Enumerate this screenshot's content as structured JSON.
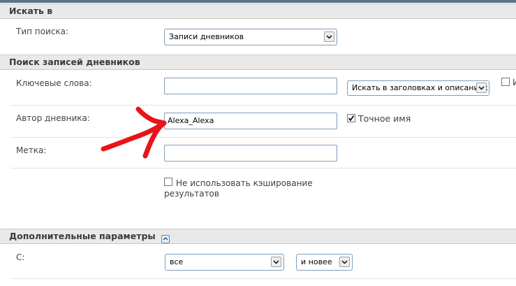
{
  "sections": {
    "search_in": {
      "title": "Искать в",
      "search_type_label": "Тип поиска:",
      "search_type_value": "Записи дневников"
    },
    "diary_search": {
      "title": "Поиск записей дневников",
      "keywords_label": "Ключевые слова:",
      "keywords_value": "",
      "search_scope_value": "Искать в заголовках и описаниях",
      "extra_checkbox_label": "И",
      "author_label": "Автор дневника:",
      "author_value": "Alexa_Alexa",
      "exact_name_label": "Точное имя",
      "exact_name_checked": true,
      "tag_label": "Метка:",
      "tag_value": "",
      "no_cache_label_line1": "Не использовать кэширование",
      "no_cache_label_line2": "результатов",
      "no_cache_checked": false
    },
    "advanced": {
      "title": "Дополнительные параметры",
      "from_label": "С:",
      "from_value": "все",
      "direction_value": "и новее"
    }
  },
  "annotation": {
    "arrow_color": "#e8141b"
  },
  "icons": [
    "dropdown-arrow-icon",
    "checkbox-checked-icon",
    "collapse-toggle-icon",
    "red-arrow-annotation"
  ]
}
